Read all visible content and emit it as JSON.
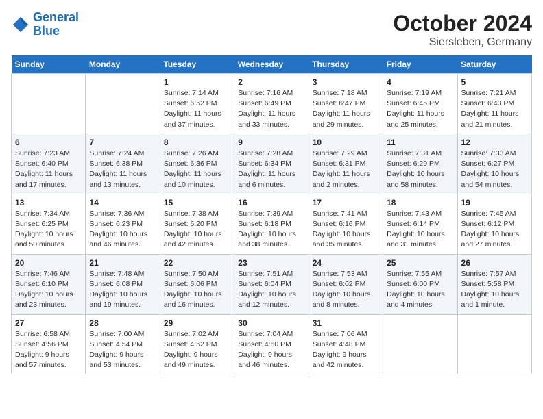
{
  "header": {
    "logo_line1": "General",
    "logo_line2": "Blue",
    "title": "October 2024",
    "subtitle": "Siersleben, Germany"
  },
  "weekdays": [
    "Sunday",
    "Monday",
    "Tuesday",
    "Wednesday",
    "Thursday",
    "Friday",
    "Saturday"
  ],
  "weeks": [
    [
      {
        "num": "",
        "info": ""
      },
      {
        "num": "",
        "info": ""
      },
      {
        "num": "1",
        "info": "Sunrise: 7:14 AM\nSunset: 6:52 PM\nDaylight: 11 hours and 37 minutes."
      },
      {
        "num": "2",
        "info": "Sunrise: 7:16 AM\nSunset: 6:49 PM\nDaylight: 11 hours and 33 minutes."
      },
      {
        "num": "3",
        "info": "Sunrise: 7:18 AM\nSunset: 6:47 PM\nDaylight: 11 hours and 29 minutes."
      },
      {
        "num": "4",
        "info": "Sunrise: 7:19 AM\nSunset: 6:45 PM\nDaylight: 11 hours and 25 minutes."
      },
      {
        "num": "5",
        "info": "Sunrise: 7:21 AM\nSunset: 6:43 PM\nDaylight: 11 hours and 21 minutes."
      }
    ],
    [
      {
        "num": "6",
        "info": "Sunrise: 7:23 AM\nSunset: 6:40 PM\nDaylight: 11 hours and 17 minutes."
      },
      {
        "num": "7",
        "info": "Sunrise: 7:24 AM\nSunset: 6:38 PM\nDaylight: 11 hours and 13 minutes."
      },
      {
        "num": "8",
        "info": "Sunrise: 7:26 AM\nSunset: 6:36 PM\nDaylight: 11 hours and 10 minutes."
      },
      {
        "num": "9",
        "info": "Sunrise: 7:28 AM\nSunset: 6:34 PM\nDaylight: 11 hours and 6 minutes."
      },
      {
        "num": "10",
        "info": "Sunrise: 7:29 AM\nSunset: 6:31 PM\nDaylight: 11 hours and 2 minutes."
      },
      {
        "num": "11",
        "info": "Sunrise: 7:31 AM\nSunset: 6:29 PM\nDaylight: 10 hours and 58 minutes."
      },
      {
        "num": "12",
        "info": "Sunrise: 7:33 AM\nSunset: 6:27 PM\nDaylight: 10 hours and 54 minutes."
      }
    ],
    [
      {
        "num": "13",
        "info": "Sunrise: 7:34 AM\nSunset: 6:25 PM\nDaylight: 10 hours and 50 minutes."
      },
      {
        "num": "14",
        "info": "Sunrise: 7:36 AM\nSunset: 6:23 PM\nDaylight: 10 hours and 46 minutes."
      },
      {
        "num": "15",
        "info": "Sunrise: 7:38 AM\nSunset: 6:20 PM\nDaylight: 10 hours and 42 minutes."
      },
      {
        "num": "16",
        "info": "Sunrise: 7:39 AM\nSunset: 6:18 PM\nDaylight: 10 hours and 38 minutes."
      },
      {
        "num": "17",
        "info": "Sunrise: 7:41 AM\nSunset: 6:16 PM\nDaylight: 10 hours and 35 minutes."
      },
      {
        "num": "18",
        "info": "Sunrise: 7:43 AM\nSunset: 6:14 PM\nDaylight: 10 hours and 31 minutes."
      },
      {
        "num": "19",
        "info": "Sunrise: 7:45 AM\nSunset: 6:12 PM\nDaylight: 10 hours and 27 minutes."
      }
    ],
    [
      {
        "num": "20",
        "info": "Sunrise: 7:46 AM\nSunset: 6:10 PM\nDaylight: 10 hours and 23 minutes."
      },
      {
        "num": "21",
        "info": "Sunrise: 7:48 AM\nSunset: 6:08 PM\nDaylight: 10 hours and 19 minutes."
      },
      {
        "num": "22",
        "info": "Sunrise: 7:50 AM\nSunset: 6:06 PM\nDaylight: 10 hours and 16 minutes."
      },
      {
        "num": "23",
        "info": "Sunrise: 7:51 AM\nSunset: 6:04 PM\nDaylight: 10 hours and 12 minutes."
      },
      {
        "num": "24",
        "info": "Sunrise: 7:53 AM\nSunset: 6:02 PM\nDaylight: 10 hours and 8 minutes."
      },
      {
        "num": "25",
        "info": "Sunrise: 7:55 AM\nSunset: 6:00 PM\nDaylight: 10 hours and 4 minutes."
      },
      {
        "num": "26",
        "info": "Sunrise: 7:57 AM\nSunset: 5:58 PM\nDaylight: 10 hours and 1 minute."
      }
    ],
    [
      {
        "num": "27",
        "info": "Sunrise: 6:58 AM\nSunset: 4:56 PM\nDaylight: 9 hours and 57 minutes."
      },
      {
        "num": "28",
        "info": "Sunrise: 7:00 AM\nSunset: 4:54 PM\nDaylight: 9 hours and 53 minutes."
      },
      {
        "num": "29",
        "info": "Sunrise: 7:02 AM\nSunset: 4:52 PM\nDaylight: 9 hours and 49 minutes."
      },
      {
        "num": "30",
        "info": "Sunrise: 7:04 AM\nSunset: 4:50 PM\nDaylight: 9 hours and 46 minutes."
      },
      {
        "num": "31",
        "info": "Sunrise: 7:06 AM\nSunset: 4:48 PM\nDaylight: 9 hours and 42 minutes."
      },
      {
        "num": "",
        "info": ""
      },
      {
        "num": "",
        "info": ""
      }
    ]
  ]
}
